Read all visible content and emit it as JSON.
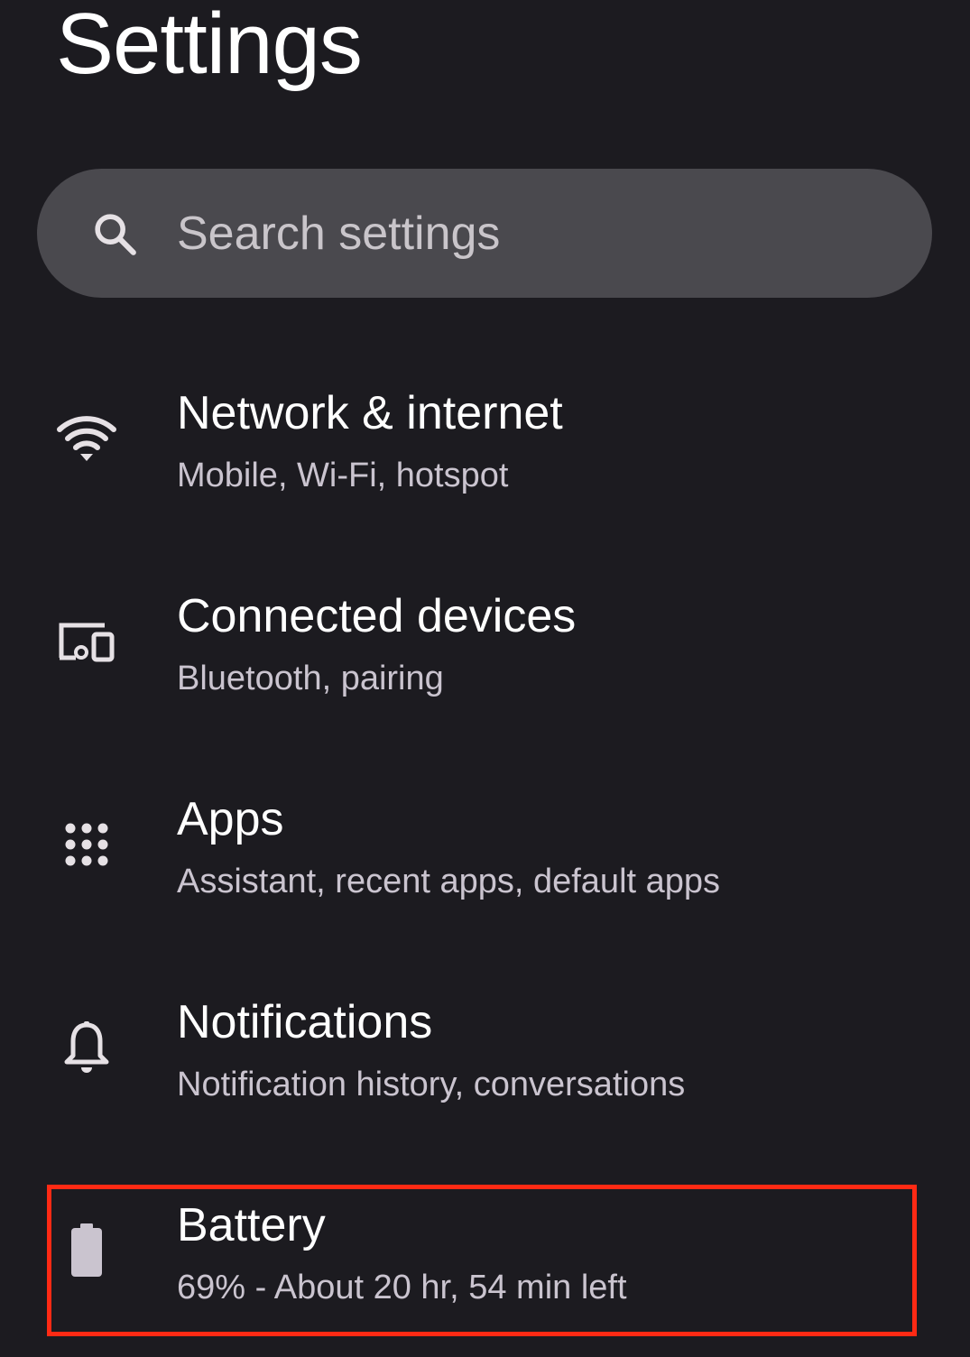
{
  "header": {
    "title": "Settings"
  },
  "search": {
    "placeholder": "Search settings",
    "icon": "search-icon"
  },
  "items": [
    {
      "title": "Network & internet",
      "subtitle": "Mobile, Wi-Fi, hotspot",
      "icon": "wifi-icon"
    },
    {
      "title": "Connected devices",
      "subtitle": "Bluetooth, pairing",
      "icon": "connected-devices-icon"
    },
    {
      "title": "Apps",
      "subtitle": "Assistant, recent apps, default apps",
      "icon": "apps-grid-icon"
    },
    {
      "title": "Notifications",
      "subtitle": "Notification history, conversations",
      "icon": "bell-icon"
    },
    {
      "title": "Battery",
      "subtitle": "69% - About 20 hr, 54 min left",
      "icon": "battery-icon",
      "battery_level": 0.69,
      "highlighted": true
    }
  ],
  "colors": {
    "background": "#1c1b20",
    "search_bg": "#4a494e",
    "title_text": "#ffffff",
    "subtitle_text": "#cac4cf",
    "highlight": "#ff2a14"
  }
}
